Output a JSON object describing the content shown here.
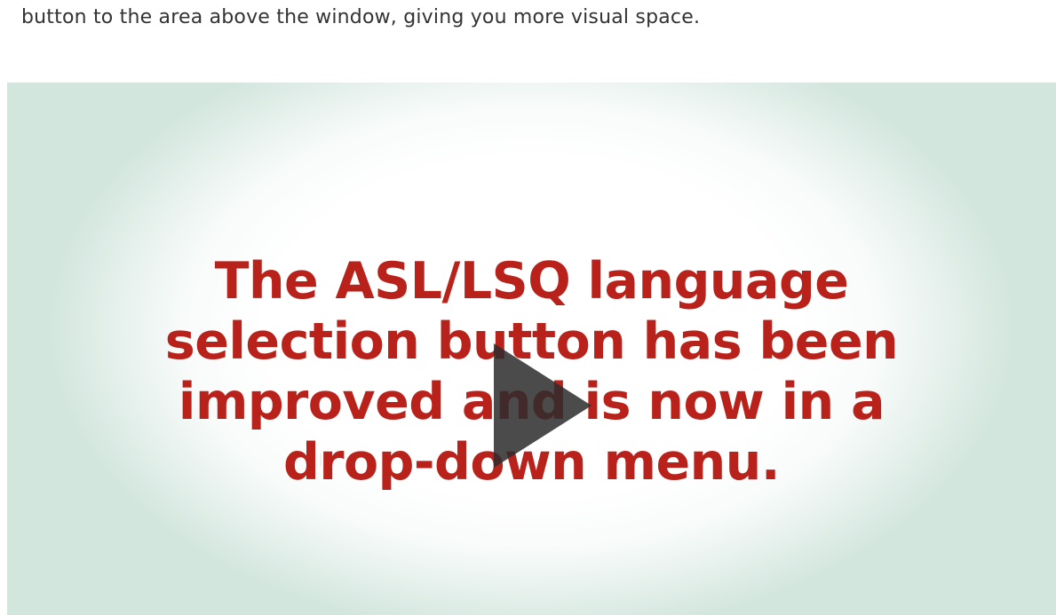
{
  "intro": {
    "text": "button to the area above the window, giving you more visual space."
  },
  "video": {
    "slide_lines": [
      "The ASL/LSQ language",
      "selection button has been",
      "improved and is now in a",
      "drop-down menu."
    ],
    "play_icon": "play-icon",
    "colors": {
      "slide_text": "#b8221b",
      "background_tint": "#d3e6de",
      "play_icon": "#2b2b2b"
    }
  }
}
